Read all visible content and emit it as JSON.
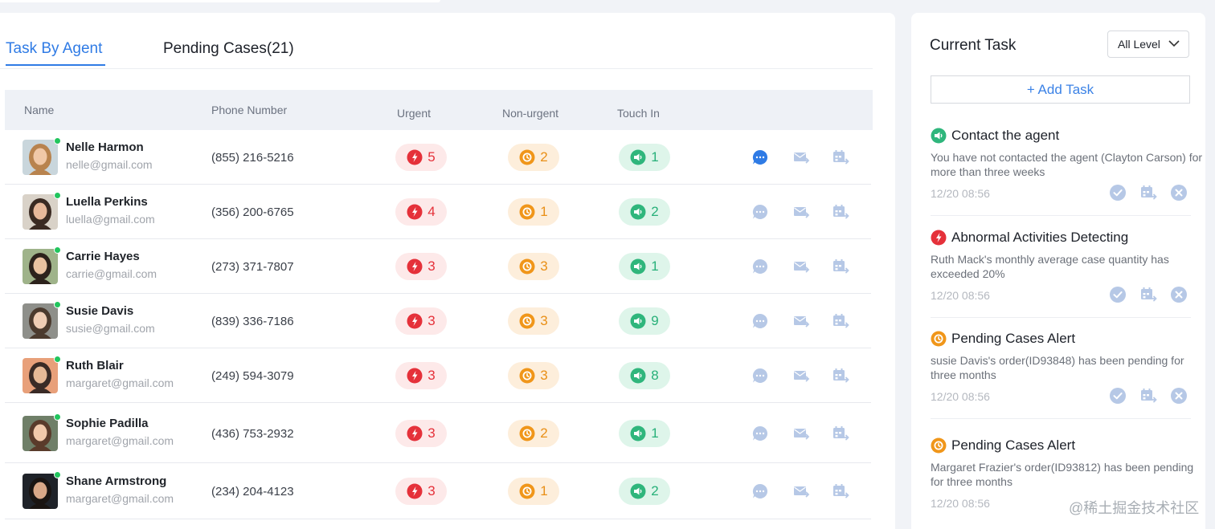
{
  "tabs": [
    {
      "label": "Task By Agent",
      "active": true
    },
    {
      "label": "Pending Cases(21)",
      "active": false
    }
  ],
  "table": {
    "headers": {
      "name": "Name",
      "phone": "Phone Number",
      "urgent": "Urgent",
      "nonurgent": "Non-urgent",
      "touch": "Touch In"
    },
    "rows": [
      {
        "name": "Nelle Harmon",
        "email": "nelle@gmail.com",
        "phone": "(855) 216-5216",
        "urgent": "5",
        "nonurgent": "2",
        "touch": "1"
      },
      {
        "name": "Luella Perkins",
        "email": "luella@gmail.com",
        "phone": "(356) 200-6765",
        "urgent": "4",
        "nonurgent": "1",
        "touch": "2"
      },
      {
        "name": "Carrie Hayes",
        "email": "carrie@gmail.com",
        "phone": "(273) 371-7807",
        "urgent": "3",
        "nonurgent": "3",
        "touch": "1"
      },
      {
        "name": "Susie Davis",
        "email": "susie@gmail.com",
        "phone": "(839) 336-7186",
        "urgent": "3",
        "nonurgent": "3",
        "touch": "9"
      },
      {
        "name": "Ruth Blair",
        "email": "margaret@gmail.com",
        "phone": "(249) 594-3079",
        "urgent": "3",
        "nonurgent": "3",
        "touch": "8"
      },
      {
        "name": "Sophie Padilla",
        "email": "margaret@gmail.com",
        "phone": "(436) 753-2932",
        "urgent": "3",
        "nonurgent": "2",
        "touch": "1"
      },
      {
        "name": "Shane Armstrong",
        "email": "margaret@gmail.com",
        "phone": "(234) 204-4123",
        "urgent": "3",
        "nonurgent": "1",
        "touch": "2"
      }
    ]
  },
  "side": {
    "title": "Current Task",
    "level_select": "All Level",
    "add_task": "+ Add  Task",
    "tasks": [
      {
        "type": "touch",
        "title": "Contact the agent",
        "desc": "You have not contacted the agent (Clayton Carson) for more than three weeks",
        "time": "12/20 08:56"
      },
      {
        "type": "urgent",
        "title": "Abnormal Activities Detecting",
        "desc": "Ruth Mack's monthly average case quantity has exceeded 20%",
        "time": "12/20 08:56"
      },
      {
        "type": "pending",
        "title": "Pending Cases Alert",
        "desc": "susie Davis's order(ID93848) has been pending for three months",
        "time": "12/20 08:56"
      },
      {
        "type": "pending",
        "title": "Pending Cases Alert",
        "desc": "Margaret Frazier's order(ID93812) has been pending for three months",
        "time": "12/20 08:56"
      }
    ]
  },
  "watermark": "@稀土掘金技术社区",
  "colors": {
    "accent": "#2f7be5",
    "urgent": "#e5313a",
    "nonurgent": "#f0961a",
    "touch": "#2fb67c"
  },
  "icons": {
    "urgent": "lightning-icon",
    "nonurgent": "clock-icon",
    "touch": "speaker-icon",
    "chat": "chat-bubble-icon",
    "mail": "mail-forward-icon",
    "schedule": "calendar-arrow-icon"
  }
}
